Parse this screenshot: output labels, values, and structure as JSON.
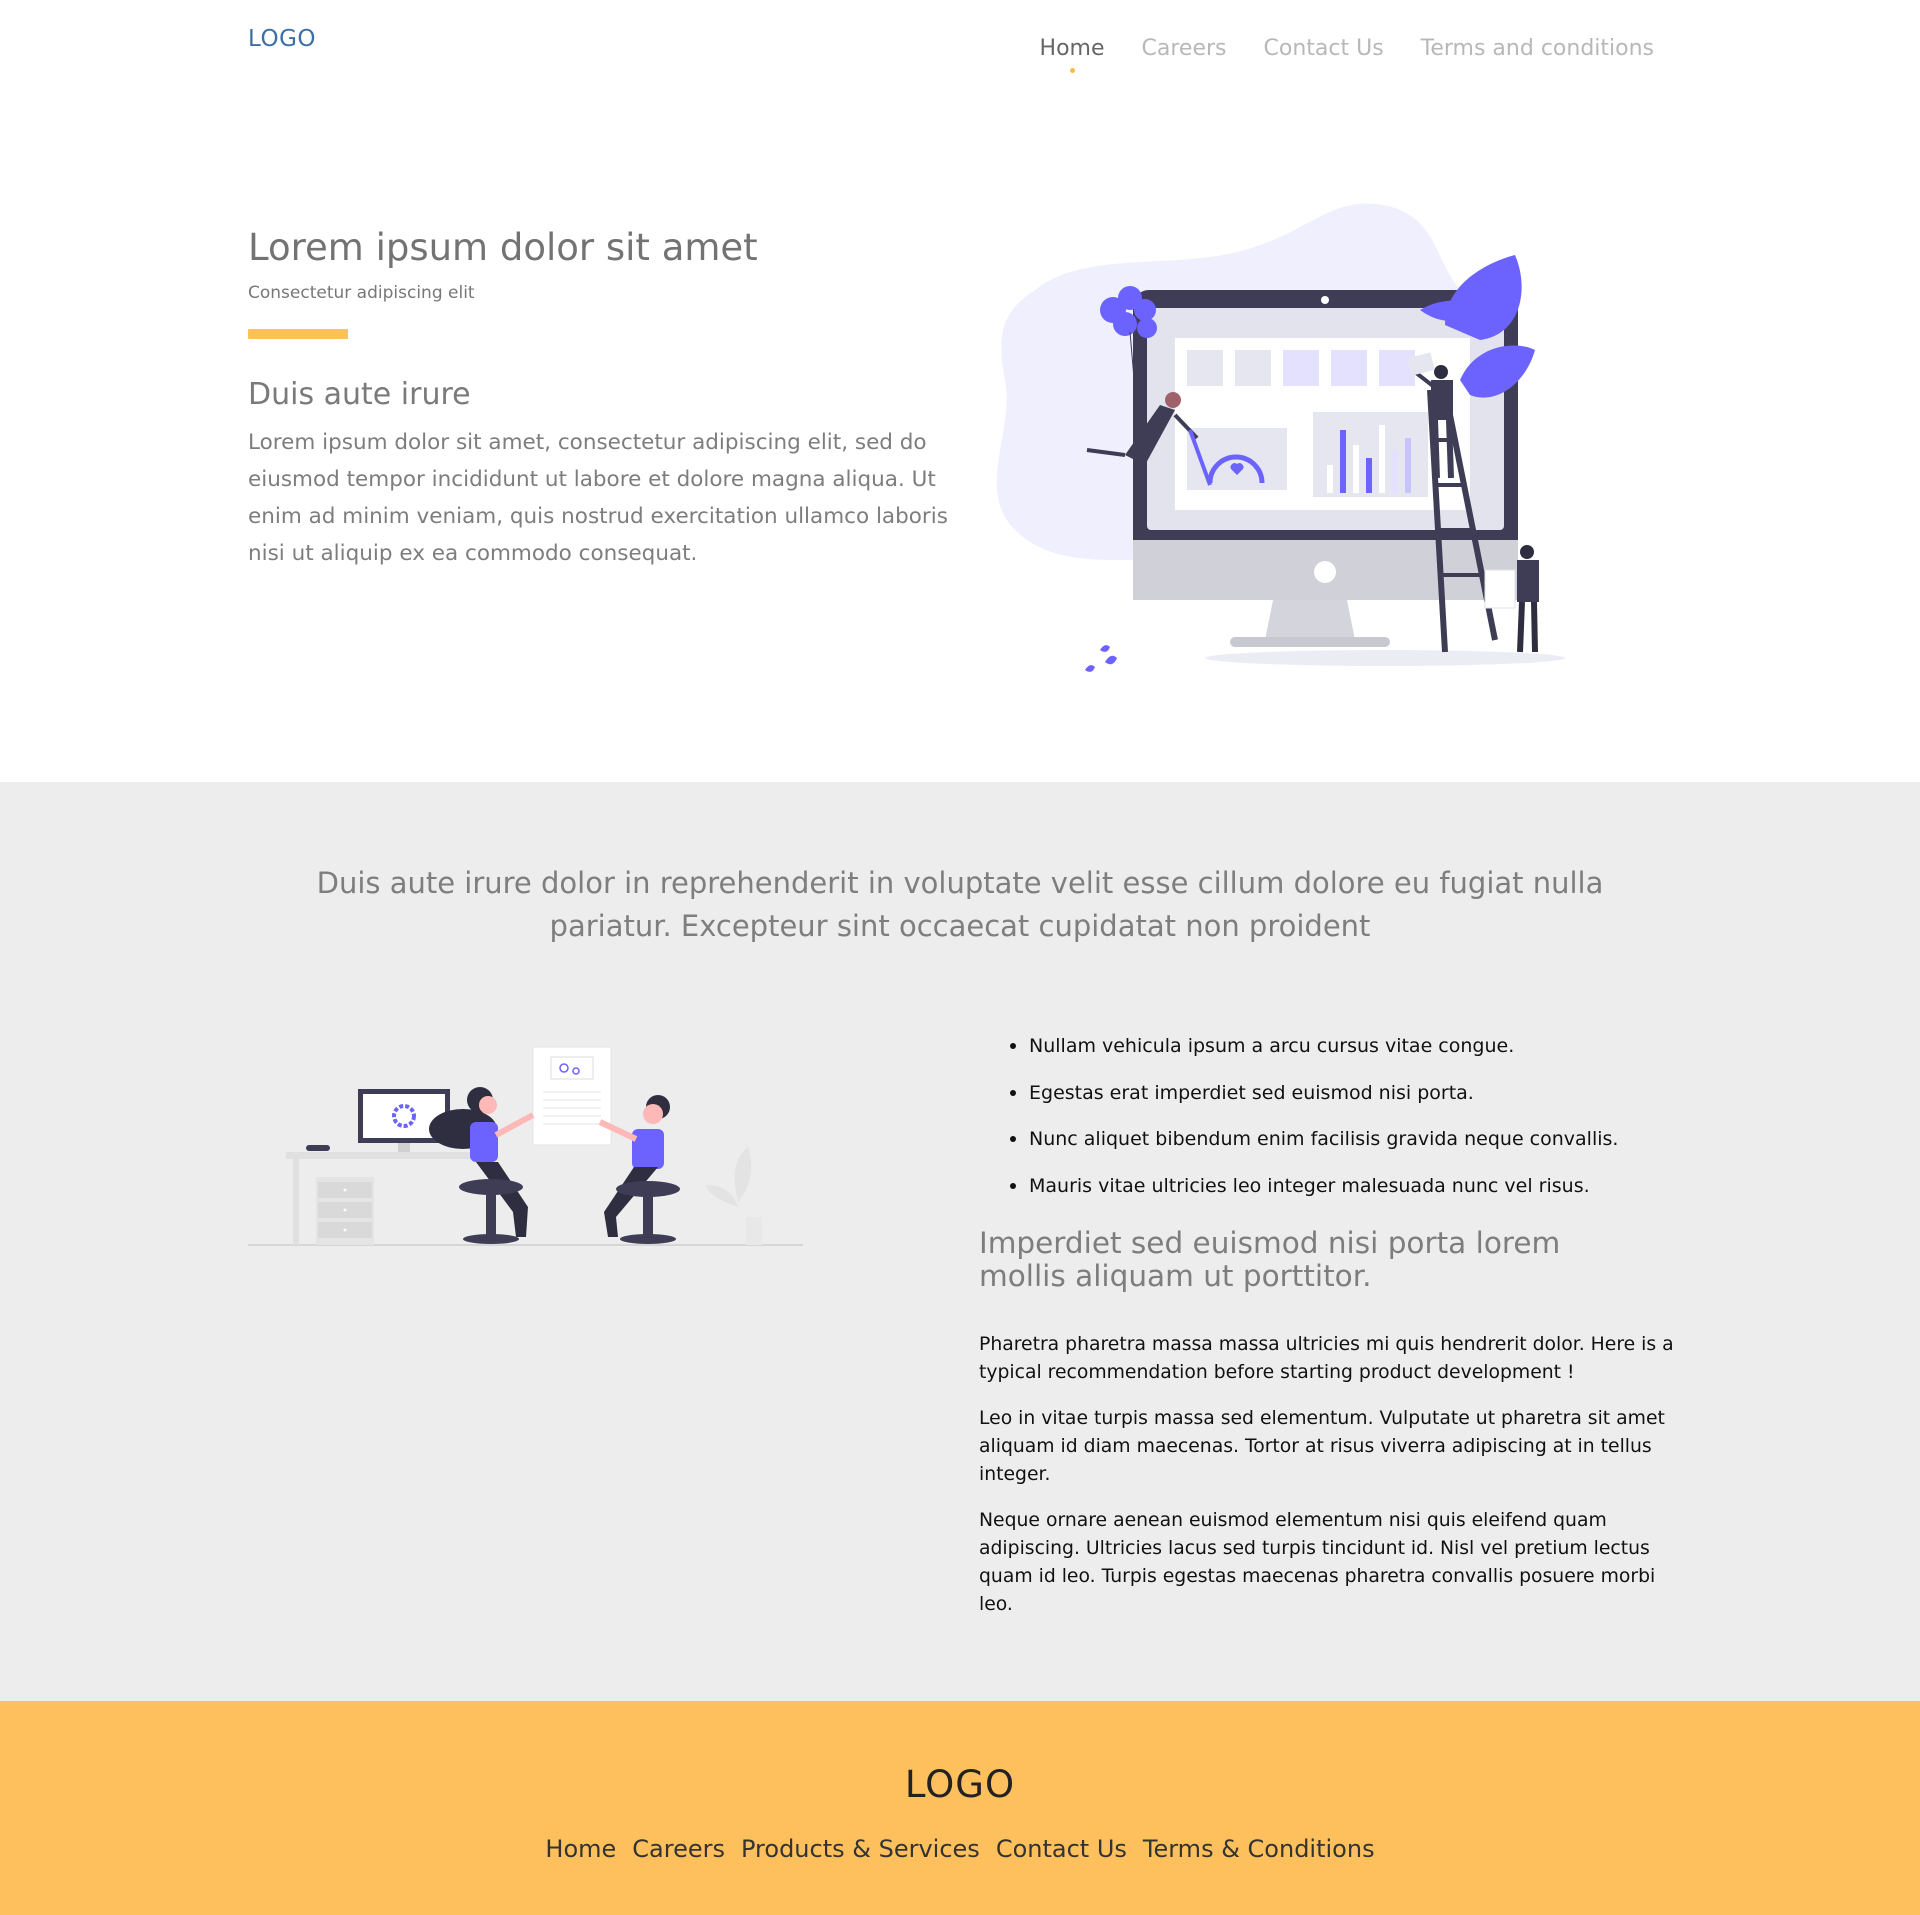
{
  "header": {
    "logo": "LOGO",
    "nav": [
      "Home",
      "Careers",
      "Contact Us",
      "Terms and conditions"
    ]
  },
  "hero": {
    "title": "Lorem ipsum dolor sit amet",
    "subtitle": "Consectetur adipiscing elit",
    "heading": "Duis aute irure",
    "paragraph": "Lorem ipsum dolor sit amet, consectetur adipiscing elit, sed do eiusmod tempor incididunt ut labore et dolore magna aliqua. Ut enim ad minim veniam, quis nostrud exercitation ullamco laboris nisi ut aliquip ex ea commodo consequat.",
    "illustration_icon": "dashboard-illustration-icon"
  },
  "middle": {
    "heading": "Duis aute irure dolor in reprehenderit in voluptate velit esse cillum dolore eu fugiat nulla pariatur. Excepteur sint occaecat cupidatat non proident",
    "bullets": [
      "Nullam vehicula ipsum a arcu cursus vitae congue.",
      "Egestas erat imperdiet sed euismod nisi porta.",
      "Nunc aliquet bibendum enim facilisis gravida neque convallis.",
      "Mauris vitae ultricies leo integer malesuada nunc vel risus."
    ],
    "subheading": "Imperdiet sed euismod nisi porta lorem mollis aliquam ut porttitor.",
    "paragraphs": [
      "Pharetra pharetra massa massa ultricies mi quis hendrerit dolor. Here is a typical recommendation before starting product development !",
      "Leo in vitae turpis massa sed elementum. Vulputate ut pharetra sit amet aliquam id diam maecenas. Tortor at risus viverra adipiscing at in tellus integer.",
      "Neque ornare aenean euismod elementum nisi quis eleifend quam adipiscing. Ultricies lacus sed turpis tincidunt id. Nisl vel pretium lectus quam id leo. Turpis egestas maecenas pharetra convallis posuere morbi leo."
    ],
    "illustration_icon": "teamwork-illustration-icon"
  },
  "footer": {
    "logo": "LOGO",
    "nav": [
      "Home",
      "Careers",
      "Products & Services",
      "Contact Us",
      "Terms & Conditions"
    ]
  },
  "colors": {
    "accent": "#fdbb44",
    "footer_bg": "#fec05c",
    "illustration_purple": "#6c63ff",
    "section_bg": "#ededed"
  }
}
